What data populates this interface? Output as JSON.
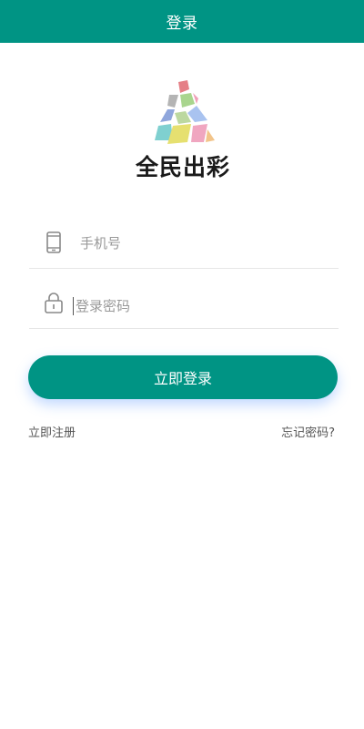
{
  "header": {
    "title": "登录",
    "background": "#009484"
  },
  "logo": {
    "text": "全民出彩"
  },
  "form": {
    "phone": {
      "placeholder": "手机号",
      "value": "",
      "icon": "phone-icon"
    },
    "password": {
      "placeholder": "登录密码",
      "value": "",
      "icon": "lock-icon"
    },
    "submit_label": "立即登录"
  },
  "links": {
    "register": "立即注册",
    "forgot": "忘记密码?"
  },
  "colors": {
    "accent": "#009484",
    "text_muted": "#999999",
    "link": "#555555"
  }
}
